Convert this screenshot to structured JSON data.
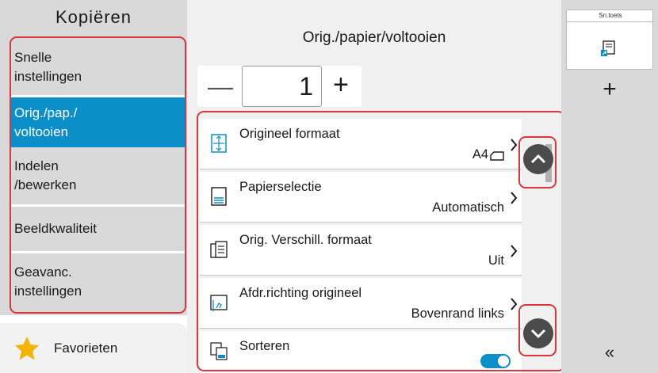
{
  "sidebar": {
    "title": "Kopiëren",
    "items": [
      {
        "label": "Snelle\ninstellingen"
      },
      {
        "label": "Orig./pap./\nvoltooien"
      },
      {
        "label": "Indelen\n/bewerken"
      },
      {
        "label": "Beeldkwaliteit"
      },
      {
        "label": "Geavanc.\ninstellingen"
      }
    ],
    "favorites_label": "Favorieten"
  },
  "main": {
    "heading": "Orig./papier/voltooien",
    "copies_value": "1",
    "minus_label": "—",
    "plus_label": "+",
    "rows": [
      {
        "label": "Origineel formaat",
        "value": "A4"
      },
      {
        "label": "Papierselectie",
        "value": "Automatisch"
      },
      {
        "label": "Orig. Verschill. formaat",
        "value": "Uit"
      },
      {
        "label": "Afdr.richting origineel",
        "value": "Bovenrand links"
      },
      {
        "label": "Sorteren",
        "value": "on"
      }
    ]
  },
  "right_panel": {
    "shortcut_label": "Sn.toets",
    "add_label": "+",
    "collapse_label": "«"
  },
  "colors": {
    "accent": "#0a8fc9",
    "highlight_border": "#d9363e",
    "star": "#f5b400"
  }
}
